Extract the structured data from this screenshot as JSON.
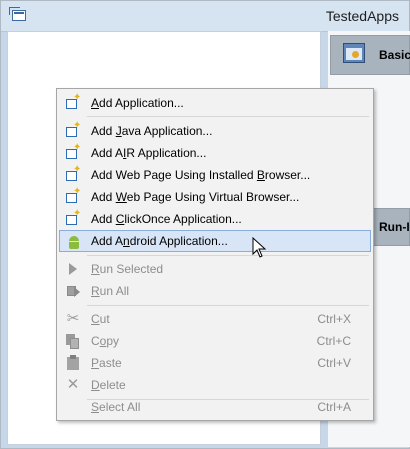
{
  "window": {
    "title": "TestedApps"
  },
  "right_panel": {
    "tiles": [
      {
        "label": "Basic",
        "icon": "settings-app-icon"
      },
      {
        "label": "Run-I"
      }
    ]
  },
  "context_menu": {
    "items": [
      {
        "icon": "add-application-icon",
        "mnemonic": "A",
        "rest": "dd Application...",
        "enabled": true
      },
      {
        "icon": "add-application-icon",
        "pre": "Add ",
        "mnemonic": "J",
        "rest": "ava Application...",
        "enabled": true
      },
      {
        "icon": "add-application-icon",
        "pre": "Add A",
        "mnemonic": "I",
        "rest": "R Application...",
        "enabled": true
      },
      {
        "icon": "add-application-icon",
        "pre": "Add Web Page Using Installed ",
        "mnemonic": "B",
        "rest": "rowser...",
        "enabled": true
      },
      {
        "icon": "add-application-icon",
        "pre": "Add ",
        "mnemonic": "W",
        "rest": "eb Page Using Virtual Browser...",
        "enabled": true
      },
      {
        "icon": "add-application-icon",
        "pre": "Add ",
        "mnemonic": "C",
        "rest": "lickOnce Application...",
        "enabled": true
      },
      {
        "icon": "android-icon",
        "pre": "Add A",
        "mnemonic": "n",
        "rest": "droid Application...",
        "enabled": true,
        "highlighted": true
      },
      {
        "icon": "run-icon",
        "mnemonic": "R",
        "rest": "un Selected",
        "enabled": false
      },
      {
        "icon": "run-all-icon",
        "mnemonic": "R",
        "rest": "un All",
        "enabled": false
      },
      {
        "icon": "cut-icon",
        "mnemonic": "C",
        "rest": "ut",
        "shortcut": "Ctrl+X",
        "enabled": false
      },
      {
        "icon": "copy-icon",
        "pre": "C",
        "mnemonic": "o",
        "rest": "py",
        "shortcut": "Ctrl+C",
        "enabled": false
      },
      {
        "icon": "paste-icon",
        "mnemonic": "P",
        "rest": "aste",
        "shortcut": "Ctrl+V",
        "enabled": false
      },
      {
        "icon": "delete-icon",
        "mnemonic": "D",
        "rest": "elete",
        "enabled": false
      },
      {
        "icon": "select-all-icon",
        "mnemonic": "S",
        "rest": "elect All",
        "shortcut": "Ctrl+A",
        "enabled": false
      }
    ]
  }
}
